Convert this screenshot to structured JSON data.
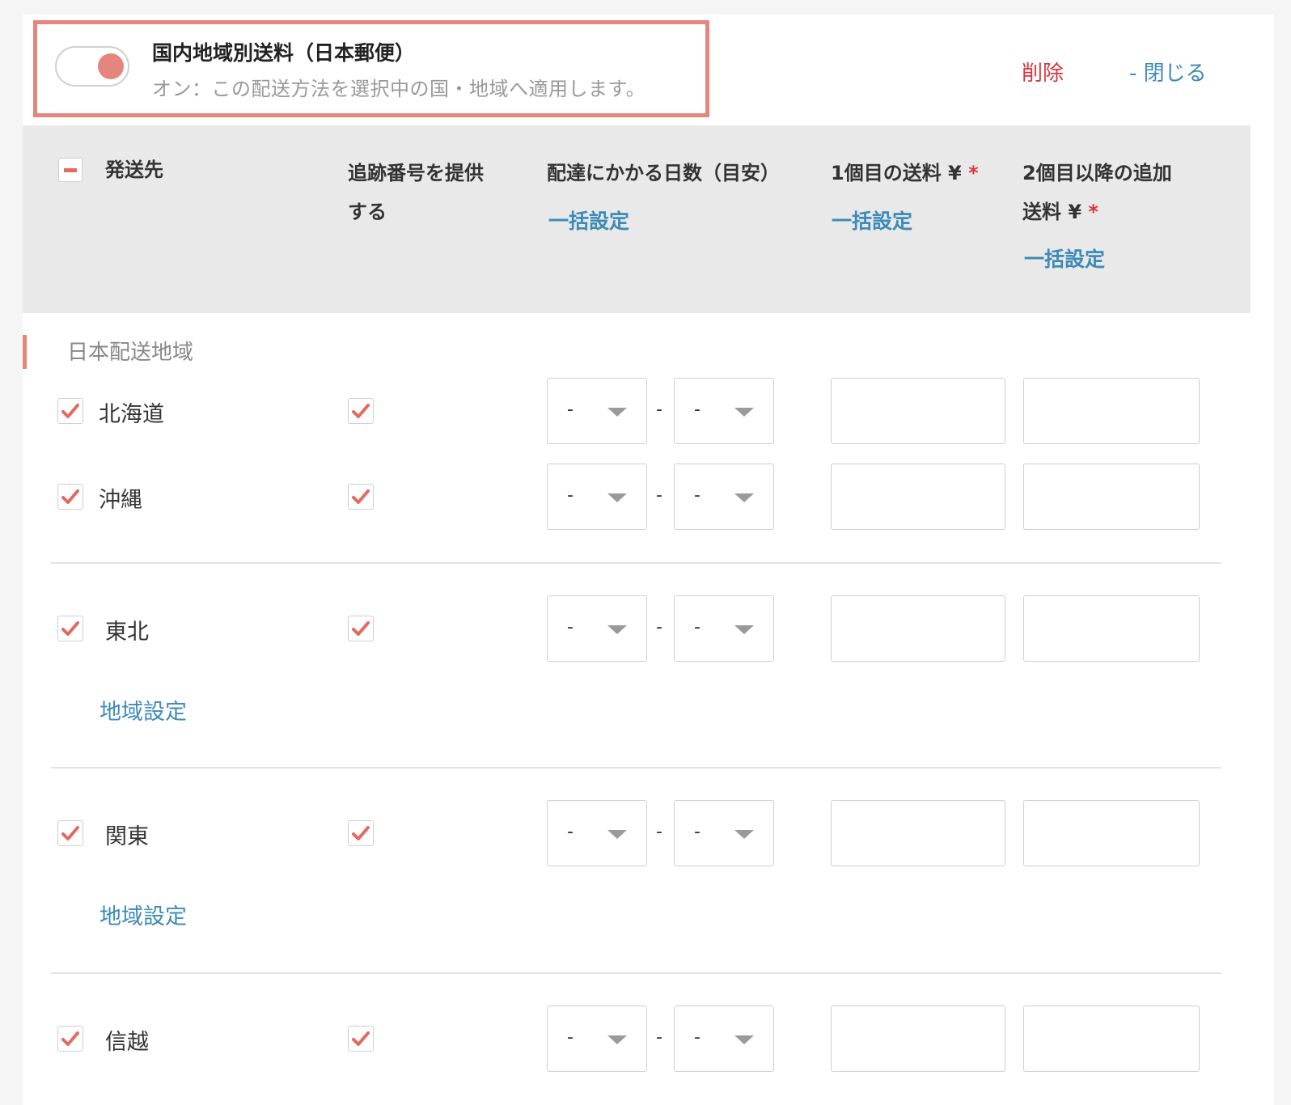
{
  "header": {
    "method_title": "国内地域別送料（日本郵便）",
    "method_desc": "オン：この配送方法を選択中の国・地域へ適用します。",
    "toggle_on": true,
    "delete_label": "削除",
    "close_label": "- 閉じる"
  },
  "columns": {
    "destination": "発送先",
    "tracking_l1": "追跡番号を提供",
    "tracking_l2": "する",
    "days": "配達にかかる日数（目安）",
    "first_fee": "1個目の送料 ¥",
    "additional_fee_l1": "2個目以降の追加",
    "additional_fee_l2": "送料 ¥",
    "required_mark": "*",
    "bulk_set": "一括設定"
  },
  "group": {
    "label": "日本配送地域"
  },
  "rows": [
    {
      "name": "北海道",
      "checked": true,
      "tracking": true,
      "days_min": "-",
      "days_max": "-",
      "first_fee": "",
      "additional_fee": "",
      "region_link": ""
    },
    {
      "name": "沖縄",
      "checked": true,
      "tracking": true,
      "days_min": "-",
      "days_max": "-",
      "first_fee": "",
      "additional_fee": "",
      "region_link": ""
    },
    {
      "name": "東北",
      "checked": true,
      "tracking": true,
      "days_min": "-",
      "days_max": "-",
      "first_fee": "",
      "additional_fee": "",
      "region_link": "地域設定"
    },
    {
      "name": "関東",
      "checked": true,
      "tracking": true,
      "days_min": "-",
      "days_max": "-",
      "first_fee": "",
      "additional_fee": "",
      "region_link": "地域設定"
    },
    {
      "name": "信越",
      "checked": true,
      "tracking": true,
      "days_min": "-",
      "days_max": "-",
      "first_fee": "",
      "additional_fee": "",
      "region_link": ""
    }
  ],
  "range_separator": "-",
  "colors": {
    "accent": "#e4857e",
    "link": "#3d8bb8",
    "danger": "#d9363e",
    "header_bg": "#e9e9e9"
  }
}
